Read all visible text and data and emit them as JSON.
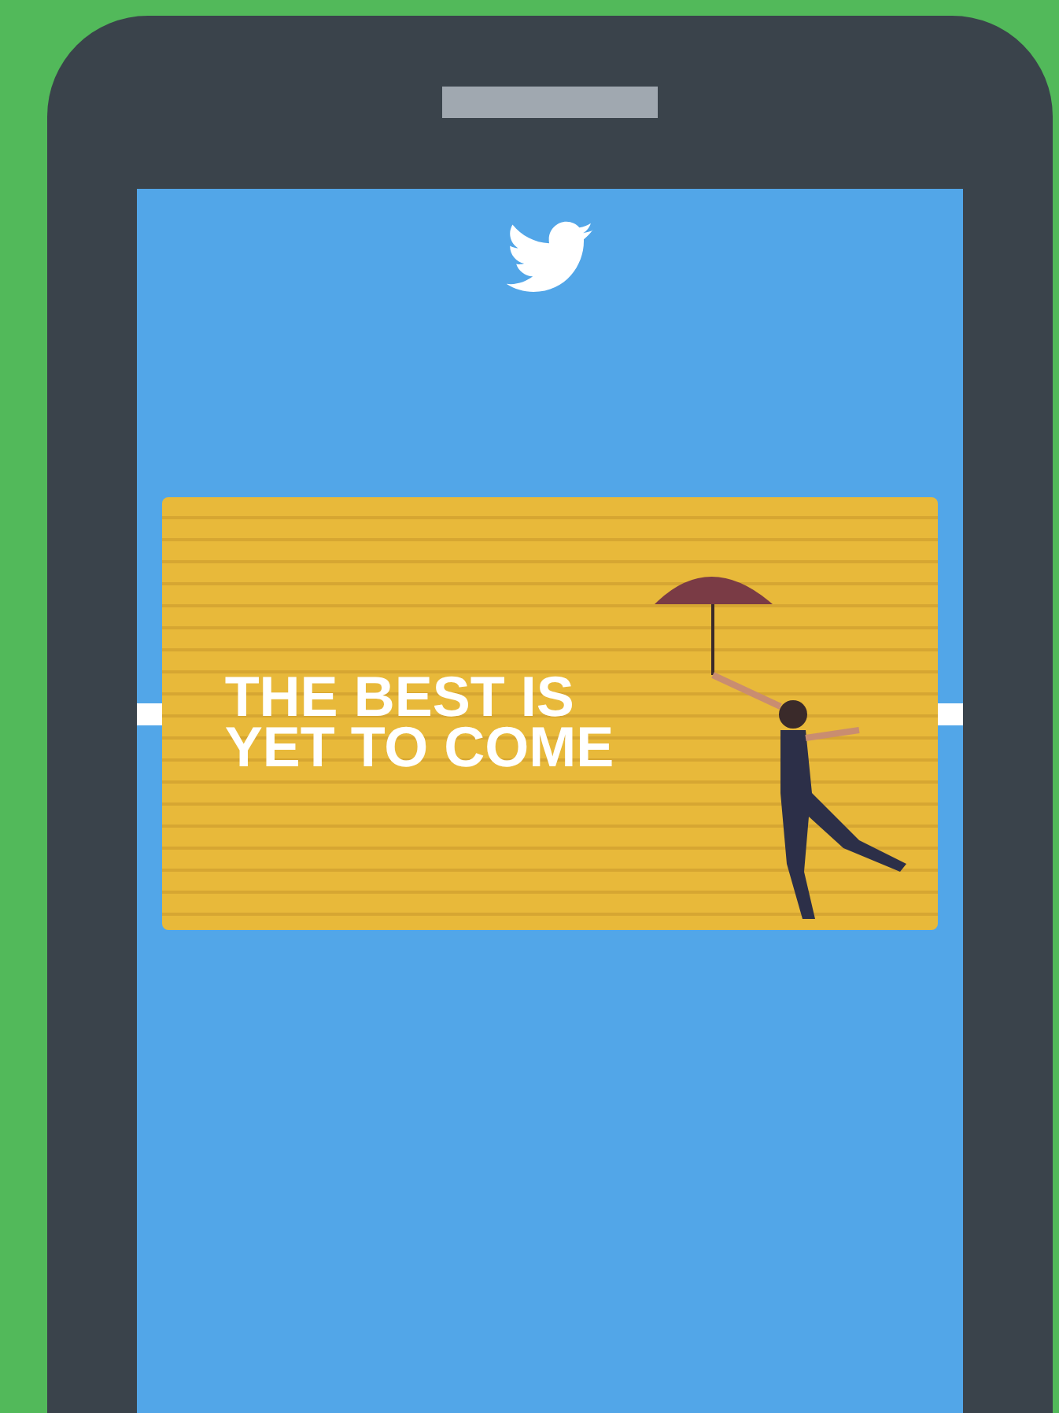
{
  "post": {
    "headline_lines": [
      "THE BEST IS",
      "YET TO COME"
    ]
  }
}
